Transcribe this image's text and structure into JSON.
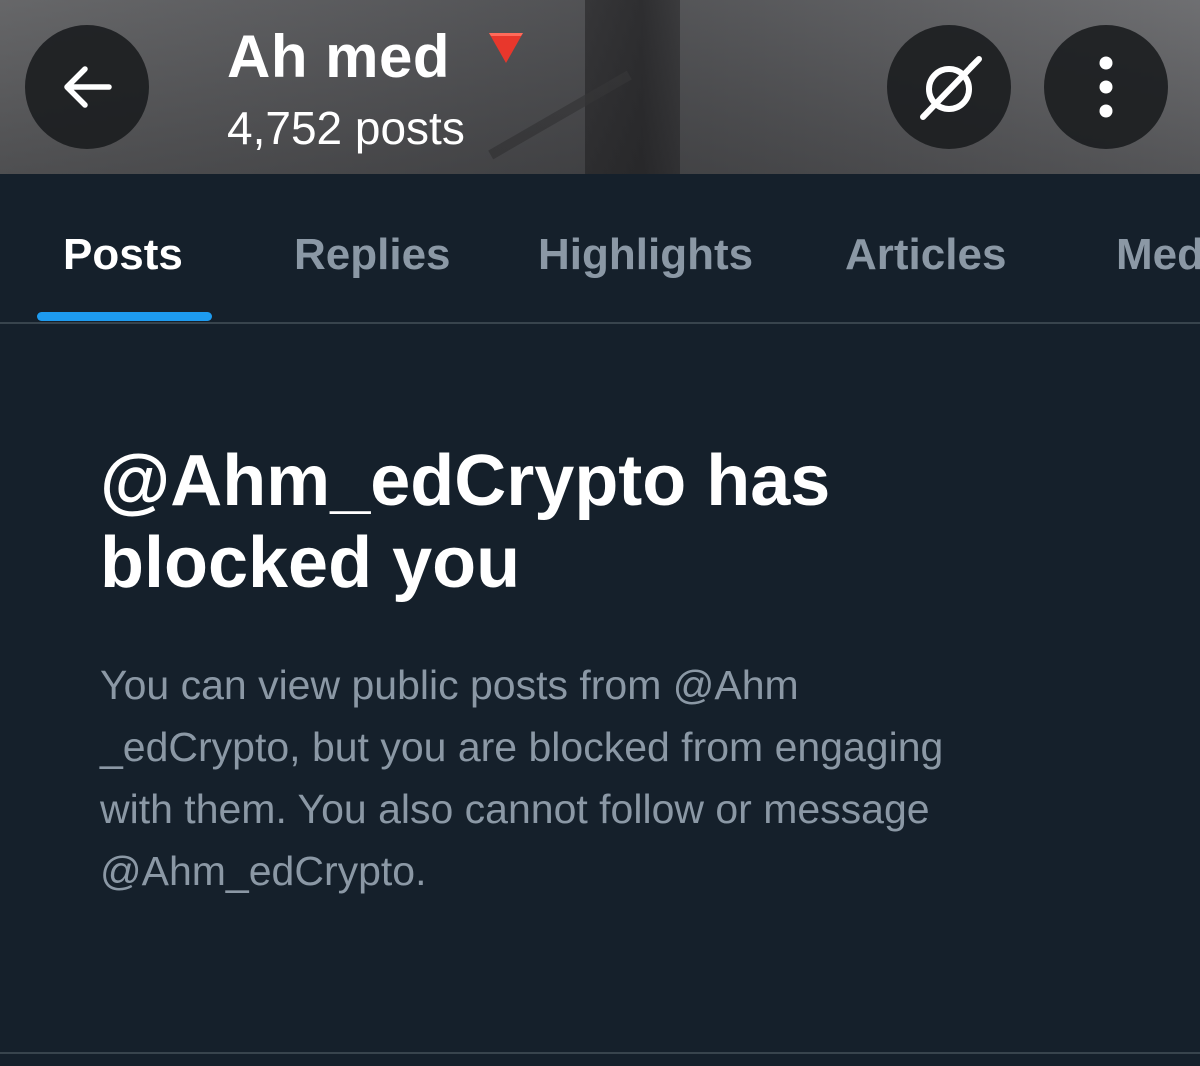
{
  "header": {
    "display_name": "Ah med",
    "name_emoji": "🔻",
    "post_count": "4,752 posts",
    "back_icon": "arrow-left-icon",
    "grok_icon": "grok-slash-icon",
    "more_icon": "more-vertical-icon"
  },
  "tabs": [
    {
      "label": "Posts",
      "active": true
    },
    {
      "label": "Replies",
      "active": false
    },
    {
      "label": "Highlights",
      "active": false
    },
    {
      "label": "Articles",
      "active": false
    },
    {
      "label": "Med",
      "active": false
    }
  ],
  "blocked": {
    "title_line1": "@Ahm_edCrypto has",
    "title_line2": "blocked you",
    "desc_line1": "You can view public posts from @Ahm",
    "desc_line2": "_edCrypto, but you are blocked from engaging",
    "desc_line3": "with them. You also cannot follow or message",
    "desc_line4": "@Ahm_edCrypto."
  },
  "colors": {
    "background": "#15202b",
    "accent": "#1d9bf0",
    "muted_text": "#8b98a5",
    "divider": "#38444d"
  }
}
